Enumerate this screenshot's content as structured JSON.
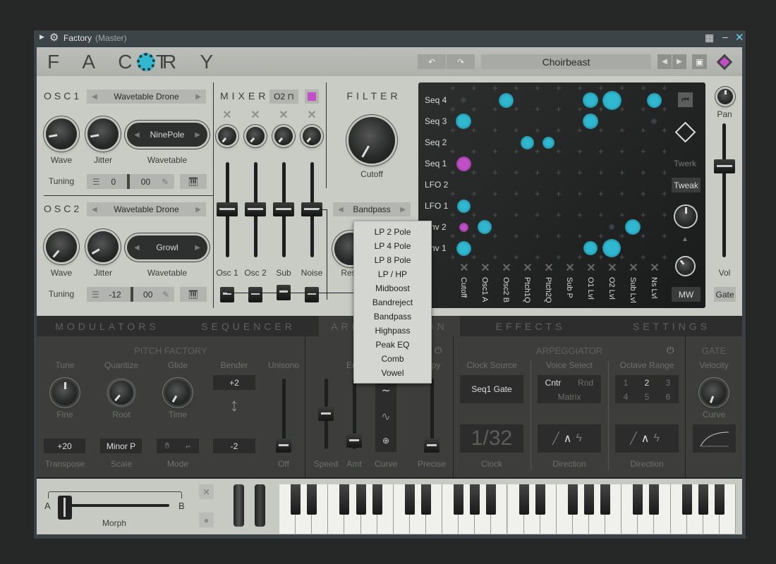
{
  "window": {
    "title": "Factory",
    "subtitle": "(Master)"
  },
  "header": {
    "logo": "FACTORY",
    "preset": "Choirbeast",
    "logo_left": "F A C T",
    "logo_right": "R Y",
    "accent": "#2fb8d0",
    "magenta": "#c24fc8"
  },
  "osc1": {
    "label": "OSC1",
    "preset": "Wavetable Drone",
    "wave": "Wave",
    "jitter": "Jitter",
    "wavetable_value": "NinePole",
    "wavetable": "Wavetable",
    "tuning": "Tuning",
    "coarse": "0",
    "fine": "00"
  },
  "osc2": {
    "label": "OSC2",
    "preset": "Wavetable Drone",
    "wave": "Wave",
    "jitter": "Jitter",
    "wavetable_value": "Growl",
    "wavetable": "Wavetable",
    "tuning": "Tuning",
    "coarse": "-12",
    "fine": "00"
  },
  "mixer": {
    "label": "MIXER",
    "osc_select": "O2",
    "channels": [
      "Osc 1",
      "Osc 2",
      "Sub",
      "Noise"
    ]
  },
  "filter": {
    "label": "FILTER",
    "cutoff": "Cutoff",
    "type": "Bandpass",
    "res": "Res"
  },
  "filter_menu": [
    "LP 2 Pole",
    "LP 4 Pole",
    "LP 8 Pole",
    "LP / HP",
    "Midboost",
    "Bandreject",
    "Bandpass",
    "Highpass",
    "Peak EQ",
    "Comb",
    "Vowel"
  ],
  "matrix": {
    "rows": [
      "Seq 4",
      "Seq 3",
      "Seq 2",
      "Seq 1",
      "LFO 2",
      "LFO 1",
      "Env 2",
      "Env 1"
    ],
    "cols": [
      "Cutoff",
      "Osc1 A",
      "Osc2 B",
      "Ptch1Q",
      "Ptch2Q",
      "Sub P",
      "O1 Lvl",
      "O2 Lvl",
      "Sub Lvl",
      "Ns Lvl"
    ],
    "cells": [
      {
        "row": 0,
        "col": 0,
        "amount": 0
      },
      {
        "row": 0,
        "col": 2,
        "amount": 0.55
      },
      {
        "row": 0,
        "col": 6,
        "amount": 0.6
      },
      {
        "row": 0,
        "col": 7,
        "amount": 0.85
      },
      {
        "row": 0,
        "col": 9,
        "amount": 0.55
      },
      {
        "row": 1,
        "col": 0,
        "amount": 0.6
      },
      {
        "row": 1,
        "col": 6,
        "amount": 0.6
      },
      {
        "row": 1,
        "col": 9,
        "amount": 0
      },
      {
        "row": 2,
        "col": 3,
        "amount": 0.45
      },
      {
        "row": 2,
        "col": 4,
        "amount": 0.35
      },
      {
        "row": 3,
        "col": 0,
        "amount": -0.55
      },
      {
        "row": 5,
        "col": 0,
        "amount": 0.45
      },
      {
        "row": 6,
        "col": 0,
        "amount": -0.15
      },
      {
        "row": 6,
        "col": 1,
        "amount": 0.5
      },
      {
        "row": 6,
        "col": 7,
        "amount": 0
      },
      {
        "row": 6,
        "col": 8,
        "amount": 0.6
      },
      {
        "row": 7,
        "col": 0,
        "amount": 0.55
      },
      {
        "row": 7,
        "col": 6,
        "amount": 0.5
      },
      {
        "row": 7,
        "col": 7,
        "amount": 0.8
      }
    ],
    "twerk": "Twerk",
    "tweak": "Tweak",
    "mw": "MW"
  },
  "master": {
    "pan": "Pan",
    "vol": "Vol",
    "gate": "Gate"
  },
  "tabs": [
    "MODULATORS",
    "SEQUENCER",
    "ARPEGGIATION",
    "EFFECTS",
    "SETTINGS"
  ],
  "pitch": {
    "title": "PITCH FACTORY",
    "tune": "Tune",
    "fine": "Fine",
    "transpose_value": "+20",
    "transpose": "Transpose",
    "quantize": "Quantize",
    "root": "Root",
    "scale_value": "Minor P",
    "scale": "Scale",
    "glide": "Glide",
    "time": "Time",
    "mode": "Mode",
    "bender": "Bender",
    "bend_up": "+2",
    "bend_down": "-2",
    "unisono": "Unisono",
    "unisono_value": "Off"
  },
  "env": {
    "title": "Envelope",
    "sloppy": "Sloppy",
    "speed": "Speed",
    "amt": "Amt",
    "curve": "Curve",
    "precise": "Precise"
  },
  "arp": {
    "title": "ARPEGGIATOR",
    "clock_source": "Clock Source",
    "clock_source_value": "Seq1 Gate",
    "clock_value": "1/32",
    "clock": "Clock",
    "voice_select": "Voice Select",
    "voice_opts": [
      "Cntr",
      "Rnd",
      "Matrix"
    ],
    "voice_active": "Cntr",
    "direction": "Direction",
    "octave_range": "Octave Range",
    "octaves": [
      "1",
      "2",
      "3",
      "4",
      "5",
      "6"
    ],
    "octave_active": "2"
  },
  "gate": {
    "title": "GATE",
    "velocity": "Velocity",
    "curve": "Curve"
  },
  "morph": {
    "a": "A",
    "b": "B",
    "label": "Morph"
  }
}
